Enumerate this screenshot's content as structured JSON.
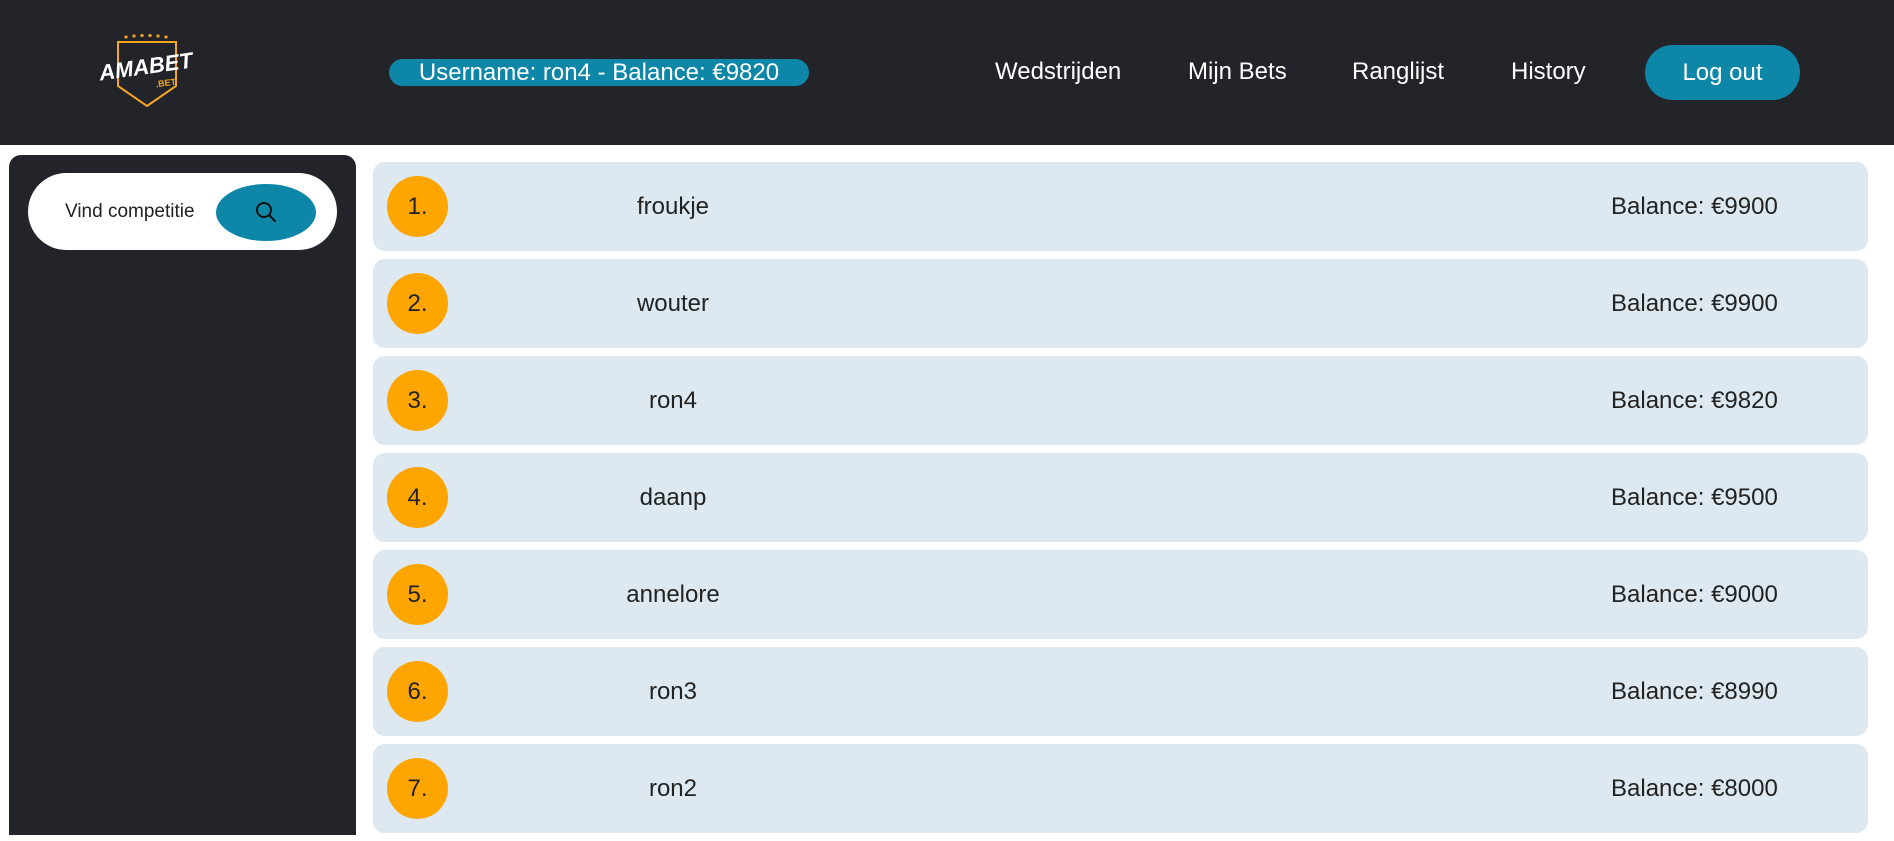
{
  "header": {
    "logo": {
      "text": "AMABET",
      "subtext": ".BET",
      "icon": "amabet-shield-logo"
    },
    "user_badge": "Username: ron4 - Balance: €9820",
    "nav": [
      {
        "label": "Wedstrijden"
      },
      {
        "label": "Mijn Bets"
      },
      {
        "label": "Ranglijst"
      },
      {
        "label": "History"
      }
    ],
    "logout_label": "Log out"
  },
  "sidebar": {
    "search_label": "Vind competitie",
    "search_icon": "search-icon"
  },
  "leaderboard": [
    {
      "rank": "1.",
      "name": "froukje",
      "balance": "Balance: €9900"
    },
    {
      "rank": "2.",
      "name": "wouter",
      "balance": "Balance: €9900"
    },
    {
      "rank": "3.",
      "name": "ron4",
      "balance": "Balance: €9820"
    },
    {
      "rank": "4.",
      "name": "daanp",
      "balance": "Balance: €9500"
    },
    {
      "rank": "5.",
      "name": "annelore",
      "balance": "Balance: €9000"
    },
    {
      "rank": "6.",
      "name": "ron3",
      "balance": "Balance: €8990"
    },
    {
      "rank": "7.",
      "name": "ron2",
      "balance": "Balance: €8000"
    }
  ],
  "colors": {
    "header_bg": "#232429",
    "accent": "#0e86a8",
    "rank_badge": "#ffa500",
    "row_bg": "#dde8f0",
    "logo_gold": "#f5a623"
  }
}
